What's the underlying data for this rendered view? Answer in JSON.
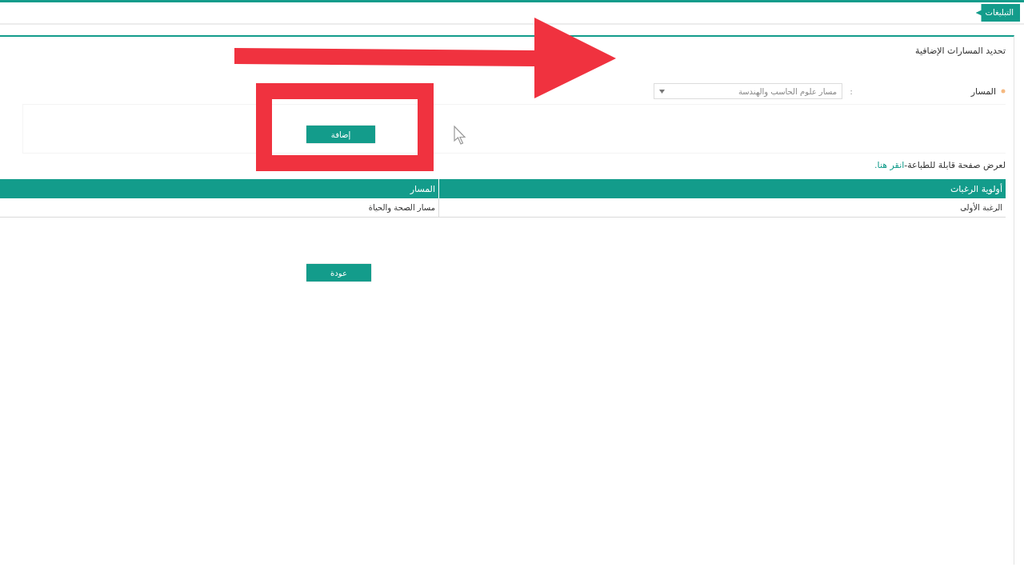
{
  "top_tab": {
    "label": "التبليغات"
  },
  "section": {
    "title": "تحديد المسارات الإضافية"
  },
  "form": {
    "field_label": "المسار",
    "required": true,
    "separator": ":",
    "dropdown": {
      "value": "مسار علوم الحاسب والهندسة"
    }
  },
  "add_button": "إضافة",
  "print_note": {
    "text": "لعرض صفحة قابلة للطباعة-",
    "link": "انقر هنا."
  },
  "table": {
    "columns": [
      "أولوية الرغبات",
      "المسار"
    ],
    "rows": [
      [
        "الرغبة الأولى",
        "مسار الصحة والحياة"
      ]
    ]
  },
  "back_button": "عودة"
}
